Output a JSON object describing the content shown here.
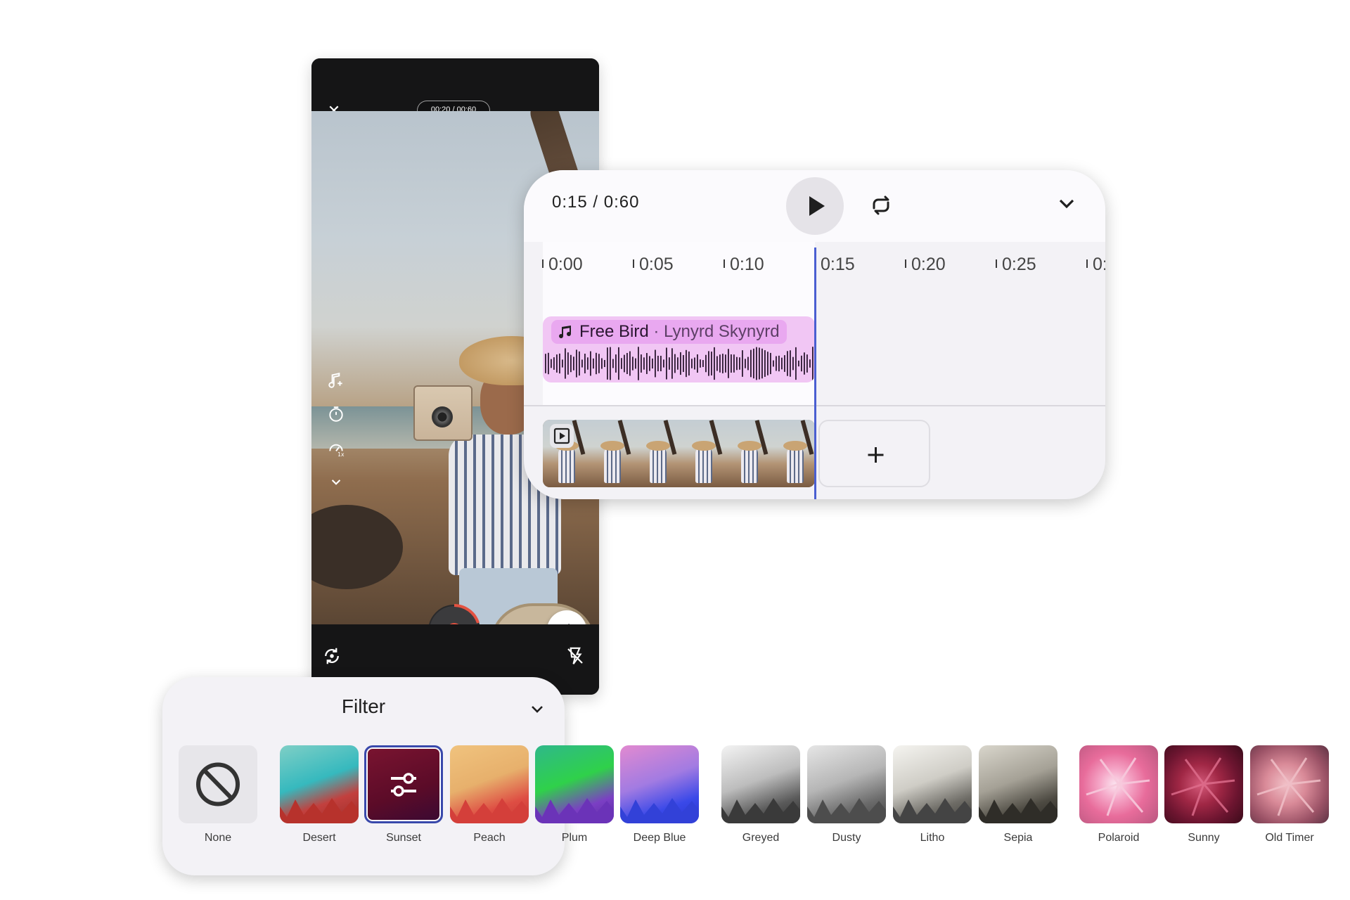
{
  "camera": {
    "timer": "00:20 / 00:60",
    "close_icon": "close-icon",
    "side_tools": [
      "music-add-icon",
      "timer-icon",
      "speed-icon",
      "chevron-down-icon"
    ],
    "record_color": "#e35241",
    "bottom_tools": [
      "flip-camera-icon",
      "flash-off-icon"
    ]
  },
  "editor": {
    "time_current": "0:15",
    "time_separator": " / ",
    "time_total": "0:60",
    "ruler": [
      "0:00",
      "0:05",
      "0:10",
      "0:15",
      "0:20",
      "0:25",
      "0:"
    ],
    "audio": {
      "title": "Free Bird",
      "separator": " · ",
      "artist": "Lynyrd Skynyrd"
    },
    "add_clip_label": "+",
    "playhead_color": "#4a5fd1"
  },
  "filter": {
    "title": "Filter",
    "selected": "Sunset",
    "items": [
      {
        "name": "None"
      },
      {
        "name": "Desert"
      },
      {
        "name": "Sunset"
      },
      {
        "name": "Peach"
      },
      {
        "name": "Plum"
      },
      {
        "name": "Deep Blue"
      },
      {
        "name": "Greyed"
      },
      {
        "name": "Dusty"
      },
      {
        "name": "Litho"
      },
      {
        "name": "Sepia"
      },
      {
        "name": "Polaroid"
      },
      {
        "name": "Sunny"
      },
      {
        "name": "Old Timer"
      }
    ]
  }
}
